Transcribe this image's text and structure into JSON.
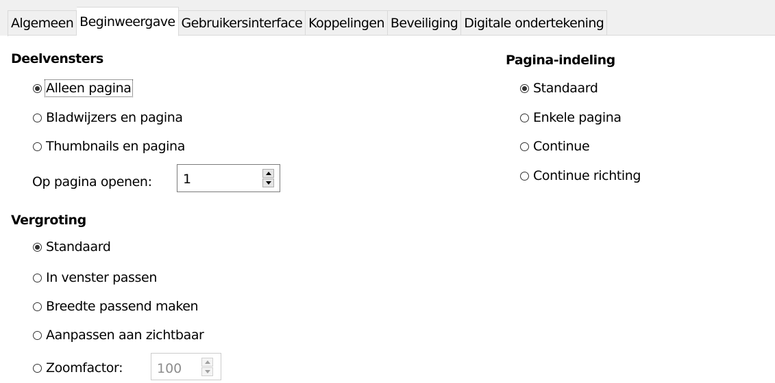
{
  "tabs": [
    {
      "label": "Algemeen",
      "active": false
    },
    {
      "label": "Beginweergave",
      "active": true
    },
    {
      "label": "Gebruikersinterface",
      "active": false
    },
    {
      "label": "Koppelingen",
      "active": false
    },
    {
      "label": "Beveiliging",
      "active": false
    },
    {
      "label": "Digitale ondertekening",
      "active": false
    }
  ],
  "panes": {
    "heading": "Deelvensters",
    "options": [
      {
        "label": "Alleen pagina",
        "checked": true
      },
      {
        "label": "Bladwijzers en pagina",
        "checked": false
      },
      {
        "label": "Thumbnails en pagina",
        "checked": false
      }
    ],
    "open_page_label": "Op pagina openen:",
    "open_page_value": "1"
  },
  "magnification": {
    "heading": "Vergroting",
    "options": [
      {
        "label": "Standaard",
        "checked": true
      },
      {
        "label": "In venster passen",
        "checked": false
      },
      {
        "label": "Breedte passend maken",
        "checked": false
      },
      {
        "label": "Aanpassen aan zichtbaar",
        "checked": false
      },
      {
        "label": "Zoomfactor:",
        "checked": false
      }
    ],
    "zoom_value": "100"
  },
  "page_layout": {
    "heading": "Pagina-indeling",
    "options": [
      {
        "label": "Standaard",
        "checked": true
      },
      {
        "label": "Enkele pagina",
        "checked": false
      },
      {
        "label": "Continue",
        "checked": false
      },
      {
        "label": "Continue richting",
        "checked": false
      }
    ]
  },
  "icons": {
    "spin_up": "triangle-up-icon",
    "spin_down": "triangle-down-icon"
  }
}
